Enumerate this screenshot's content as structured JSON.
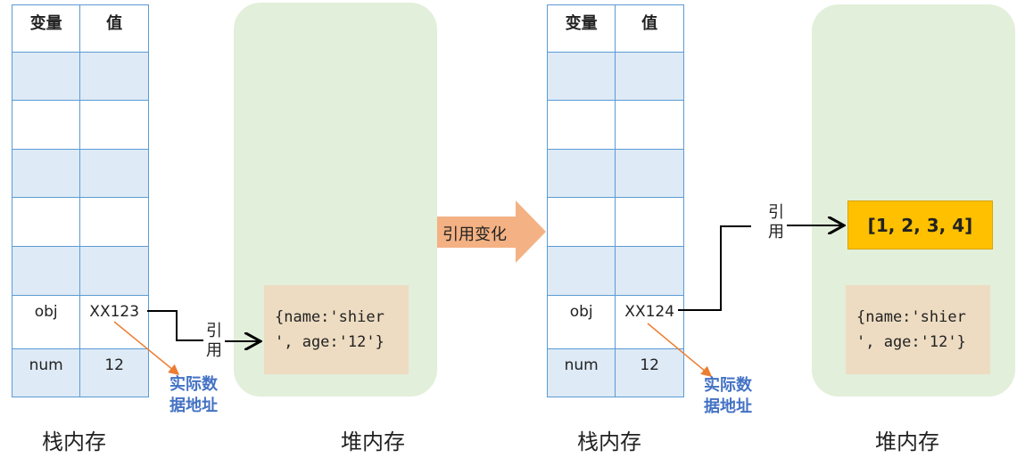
{
  "before": {
    "stack": {
      "caption": "栈内存",
      "headers": [
        "变量",
        "值"
      ],
      "rows": [
        {
          "name": "",
          "value": ""
        },
        {
          "name": "",
          "value": ""
        },
        {
          "name": "",
          "value": ""
        },
        {
          "name": "",
          "value": ""
        },
        {
          "name": "",
          "value": ""
        },
        {
          "name": "obj",
          "value": "XX123"
        },
        {
          "name": "num",
          "value": "12"
        }
      ]
    },
    "heap": {
      "caption": "堆内存",
      "object_line1": "{name:'shier",
      "object_line2": "', age:'12'}"
    },
    "reference_label_1": "引",
    "reference_label_2": "用",
    "address_note_1": "实际数",
    "address_note_2": "据地址"
  },
  "transition_label": "引用变化",
  "after": {
    "stack": {
      "caption": "栈内存",
      "headers": [
        "变量",
        "值"
      ],
      "rows": [
        {
          "name": "",
          "value": ""
        },
        {
          "name": "",
          "value": ""
        },
        {
          "name": "",
          "value": ""
        },
        {
          "name": "",
          "value": ""
        },
        {
          "name": "",
          "value": ""
        },
        {
          "name": "obj",
          "value": "XX124"
        },
        {
          "name": "num",
          "value": "12"
        }
      ]
    },
    "heap": {
      "caption": "堆内存",
      "array": "[1, 2, 3, 4]",
      "object_line1": "{name:'shier",
      "object_line2": "', age:'12'}"
    },
    "reference_label_1": "引",
    "reference_label_2": "用",
    "address_note_1": "实际数",
    "address_note_2": "据地址"
  },
  "colors": {
    "table_border": "#5B9BD5",
    "table_fill": "#DEEAF6",
    "heap": "#E2EFDA",
    "object": "#EDDCC2",
    "array": "#FFC000",
    "transition_arrow": "#F4B183",
    "note": "#4472C4",
    "pointer": "#ED7D31"
  }
}
